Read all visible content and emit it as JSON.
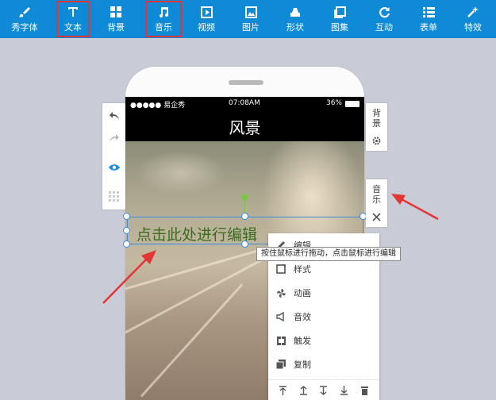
{
  "toolbar": {
    "items": [
      {
        "label": "秀字体",
        "icon": "brush-icon",
        "highlighted": false
      },
      {
        "label": "文本",
        "icon": "text-icon",
        "highlighted": true
      },
      {
        "label": "背景",
        "icon": "grid-icon",
        "highlighted": false
      },
      {
        "label": "音乐",
        "icon": "music-note-icon",
        "highlighted": true
      },
      {
        "label": "视频",
        "icon": "video-icon",
        "highlighted": false
      },
      {
        "label": "图片",
        "icon": "image-icon",
        "highlighted": false
      },
      {
        "label": "形状",
        "icon": "shape-icon",
        "highlighted": false
      },
      {
        "label": "图集",
        "icon": "gallery-icon",
        "highlighted": false
      },
      {
        "label": "互动",
        "icon": "refresh-icon",
        "highlighted": false
      },
      {
        "label": "表单",
        "icon": "list-icon",
        "highlighted": false
      },
      {
        "label": "特效",
        "icon": "sparkle-icon",
        "highlighted": false
      }
    ],
    "background": "#0e8ad6",
    "highlight_color": "#e33535"
  },
  "phone": {
    "status": {
      "carrier": "●●●●● 易企秀",
      "time": "07:08AM",
      "battery": "36%"
    },
    "page_title": "风景"
  },
  "canvas": {
    "text_element": "点击此处进行编辑",
    "text_color": "#3a6d1e"
  },
  "left_panel": {
    "buttons": [
      "undo-icon",
      "redo-icon",
      "eye-icon",
      "grid-icon"
    ]
  },
  "right_panel": {
    "background_label": "背景",
    "music_label": "音乐"
  },
  "tooltip": "按住鼠标进行拖动，点击鼠标进行编辑",
  "context_menu": {
    "items": [
      {
        "label": "编辑",
        "icon": "edit-icon"
      },
      {
        "label": "样式",
        "icon": "style-icon"
      },
      {
        "label": "动画",
        "icon": "animation-icon"
      },
      {
        "label": "音效",
        "icon": "sound-icon"
      },
      {
        "label": "触发",
        "icon": "trigger-icon"
      },
      {
        "label": "复制",
        "icon": "copy-icon"
      }
    ],
    "actions": [
      "move-top-icon",
      "move-up-icon",
      "move-down-icon",
      "move-bottom-icon",
      "delete-icon"
    ]
  }
}
